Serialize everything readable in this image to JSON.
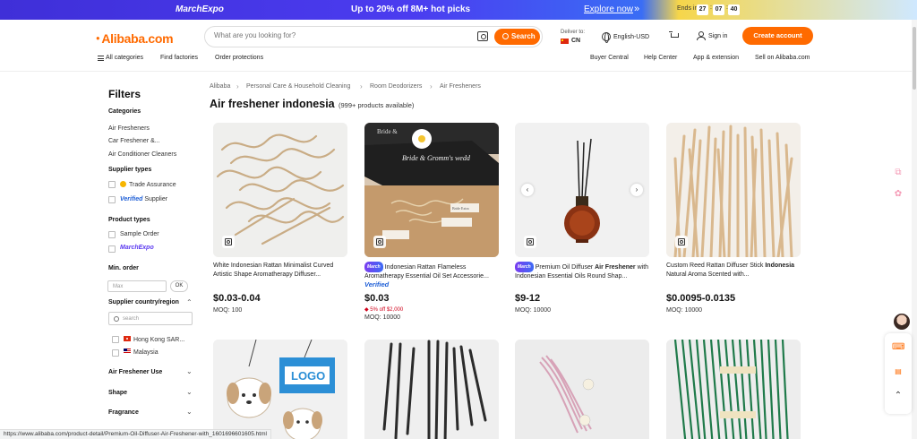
{
  "promo": {
    "brand": "MarchExpo",
    "message": "Up to 20% off 8M+ hot picks",
    "explore": "Explore now",
    "ends_label": "Ends in",
    "countdown": [
      "27",
      "07",
      "40"
    ]
  },
  "header": {
    "logo": "Alibaba.com",
    "search_placeholder": "What are you looking for?",
    "search_button": "Search",
    "deliver_to_label": "Deliver to:",
    "deliver_to_country": "CN",
    "language": "English-USD",
    "sign_in": "Sign in",
    "create_account": "Create account",
    "nav_left": [
      "All categories",
      "Find factories",
      "Order protections"
    ],
    "nav_right": [
      "Buyer Central",
      "Help Center",
      "App & extension",
      "Sell on Alibaba.com"
    ]
  },
  "breadcrumb": [
    "Alibaba",
    "Personal Care & Household Cleaning",
    "Room Deodorizers",
    "Air Fresheners"
  ],
  "page": {
    "title": "Air freshener indonesia",
    "count": "(999+ products available)"
  },
  "filters": {
    "title": "Filters",
    "categories_label": "Categories",
    "categories": [
      "Air Fresheners",
      "Car Freshener &...",
      "Air Conditioner Cleaners"
    ],
    "supplier_types_label": "Supplier types",
    "supplier_types": [
      "Trade Assurance",
      "Verified",
      "Supplier"
    ],
    "product_types_label": "Product types",
    "product_types": [
      "Sample Order",
      "MarchExpo"
    ],
    "min_order_label": "Min. order",
    "min_order_placeholder": "Max",
    "ok": "OK",
    "country_label": "Supplier country/region",
    "country_search_placeholder": "search",
    "countries": [
      "Hong Kong SAR...",
      "Malaysia"
    ],
    "collapsed": [
      "Air Freshener Use",
      "Shape",
      "Fragrance"
    ]
  },
  "products": [
    {
      "title": "White Indonesian Rattan Minimalist Curved Artistic Shape Aromatherapy Diffuser...",
      "price": "$0.03-0.04",
      "moq": "MOQ: 100"
    },
    {
      "badge": "March",
      "title": "Indonesian Rattan Flameless Aromatherapy Essential Oil Set Accessorie...",
      "verified": "Verified",
      "price": "$0.03",
      "promo": "5% off $2,000",
      "moq": "MOQ: 10000"
    },
    {
      "badge": "March",
      "title_pre": "Premium Oil Diffuser ",
      "title_bold": "Air Freshener",
      "title_post": " with Indonesian Essential Oils Round Shap...",
      "price": "$9-12",
      "moq": "MOQ: 10000"
    },
    {
      "title_pre": "Custom Reed Rattan Diffuser Stick ",
      "title_bold": "Indonesia",
      "title_post": " Natural Aroma Scented with...",
      "price": "$0.0095-0.0135",
      "moq": "MOQ: 10000"
    }
  ],
  "second_row": {
    "logo_text": "LOGO"
  },
  "status_url": "https://www.alibaba.com/product-detail/Premium-Oil-Diffuser-Air-Freshener-with_1601696601605.html",
  "image_text": {
    "box_line1": "Bride &",
    "box_line2": "Bride & Gromm's wedd",
    "tag_small": "Bride Extra"
  }
}
